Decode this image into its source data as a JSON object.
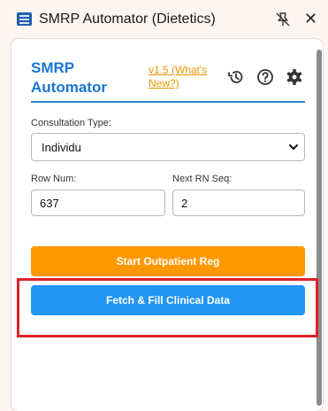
{
  "window": {
    "title": "SMRP Automator (Dietetics)",
    "close_glyph": "✕",
    "icons": [
      "app-icon",
      "pin-off-icon",
      "close-icon"
    ]
  },
  "header": {
    "brand": "SMRP\nAutomator",
    "version_link": "v1.5 (What's New?)",
    "icons": [
      "history-icon",
      "help-icon",
      "settings-icon"
    ],
    "accent_color": "#1976d2",
    "link_color": "#e69500"
  },
  "form": {
    "consultation_label": "Consultation Type:",
    "consultation_value": "Individu",
    "row_num_label": "Row Num:",
    "row_num_value": "637",
    "next_rn_label": "Next RN Seq:",
    "next_rn_value": "2"
  },
  "buttons": {
    "start_label": "Start Outpatient Reg",
    "start_color": "#ff9800",
    "fetch_label": "Fetch & Fill Clinical Data",
    "fetch_color": "#2196f3"
  },
  "annotation": {
    "highlight_color": "#e0202a"
  }
}
